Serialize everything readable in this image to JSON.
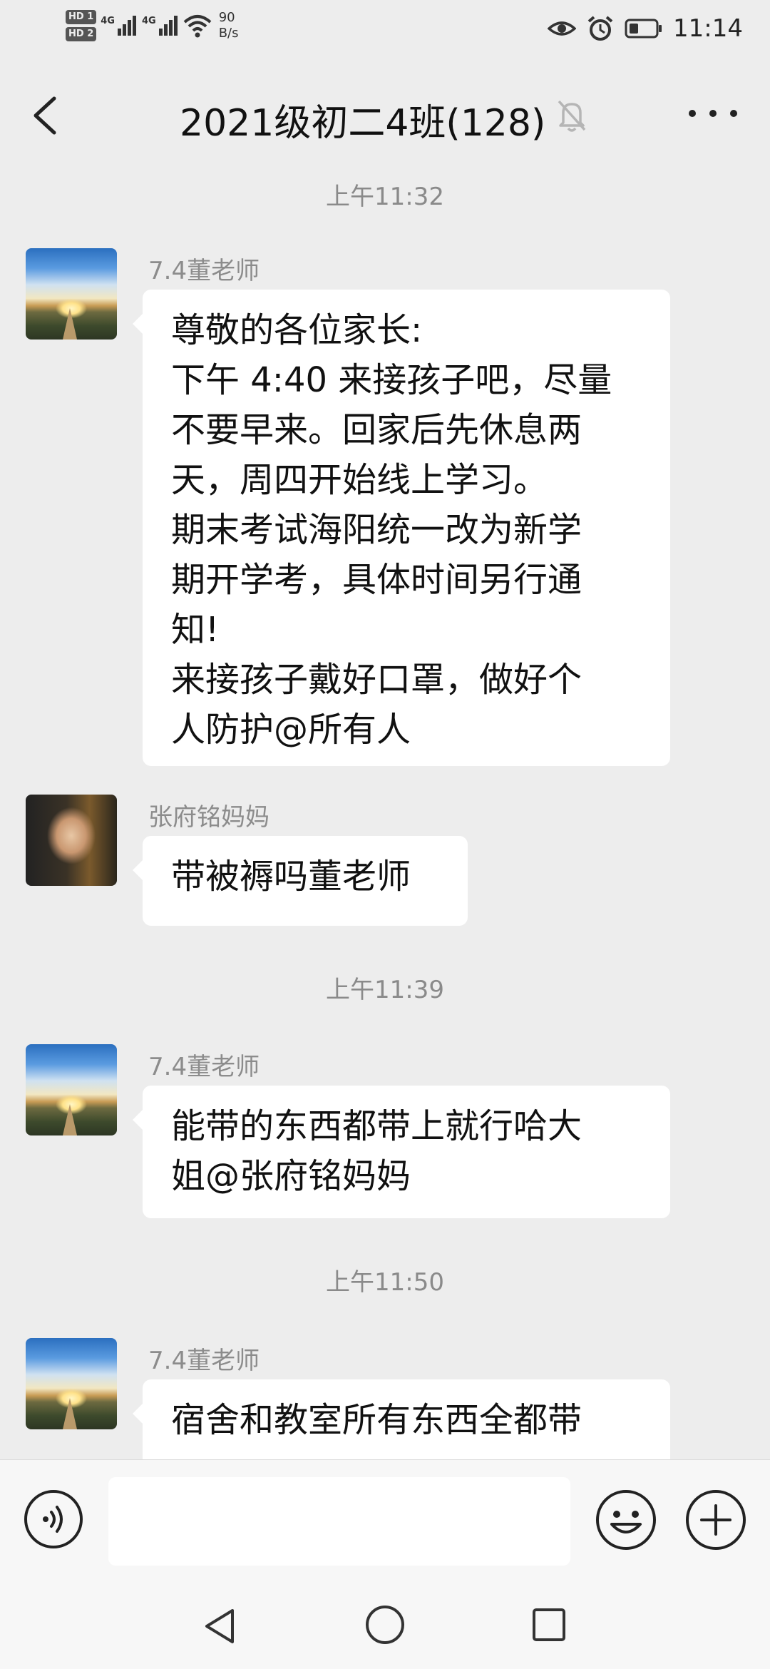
{
  "status_bar": {
    "hd_badges": [
      "HD 1",
      "HD 2"
    ],
    "network_labels": [
      "4G",
      "4G"
    ],
    "speed_value": "90",
    "speed_unit": "B/s",
    "time": "11:14",
    "icons": [
      "eye-icon",
      "alarm-icon",
      "battery-icon",
      "wifi-icon",
      "signal-icon"
    ]
  },
  "header": {
    "title": "2021级初二4班(128)",
    "icons": [
      "back-icon",
      "mute-bell-icon",
      "more-icon"
    ]
  },
  "messages": [
    {
      "timestamp": "上午11:32",
      "sender": "7.4董老师",
      "avatar": "teacher-avatar",
      "lines": [
        "尊敬的各位家长:",
        "下午 4:40 来接孩子吧，尽量",
        "不要早来。回家后先休息两",
        "天，周四开始线上学习。",
        "期末考试海阳统一改为新学",
        "期开学考，具体时间另行通",
        "知!",
        "来接孩子戴好口罩，做好个",
        "人防护@所有人"
      ]
    },
    {
      "sender": "张府铭妈妈",
      "avatar": "parent-avatar",
      "lines": [
        "带被褥吗董老师"
      ]
    },
    {
      "timestamp": "上午11:39",
      "sender": "7.4董老师",
      "avatar": "teacher-avatar",
      "lines": [
        "能带的东西都带上就行哈大",
        "姐@张府铭妈妈"
      ]
    },
    {
      "timestamp": "上午11:50",
      "sender": "7.4董老师",
      "avatar": "teacher-avatar",
      "lines": [
        "宿舍和教室所有东西全都带"
      ]
    }
  ],
  "input_bar": {
    "value": "",
    "placeholder": "",
    "icons": [
      "voice-icon",
      "emoji-icon",
      "plus-icon"
    ]
  },
  "nav_bar": {
    "icons": [
      "nav-back-icon",
      "nav-home-icon",
      "nav-recent-icon"
    ]
  },
  "colors": {
    "background": "#ededed",
    "bubble": "#ffffff",
    "muted_text": "#8a8a8a"
  }
}
